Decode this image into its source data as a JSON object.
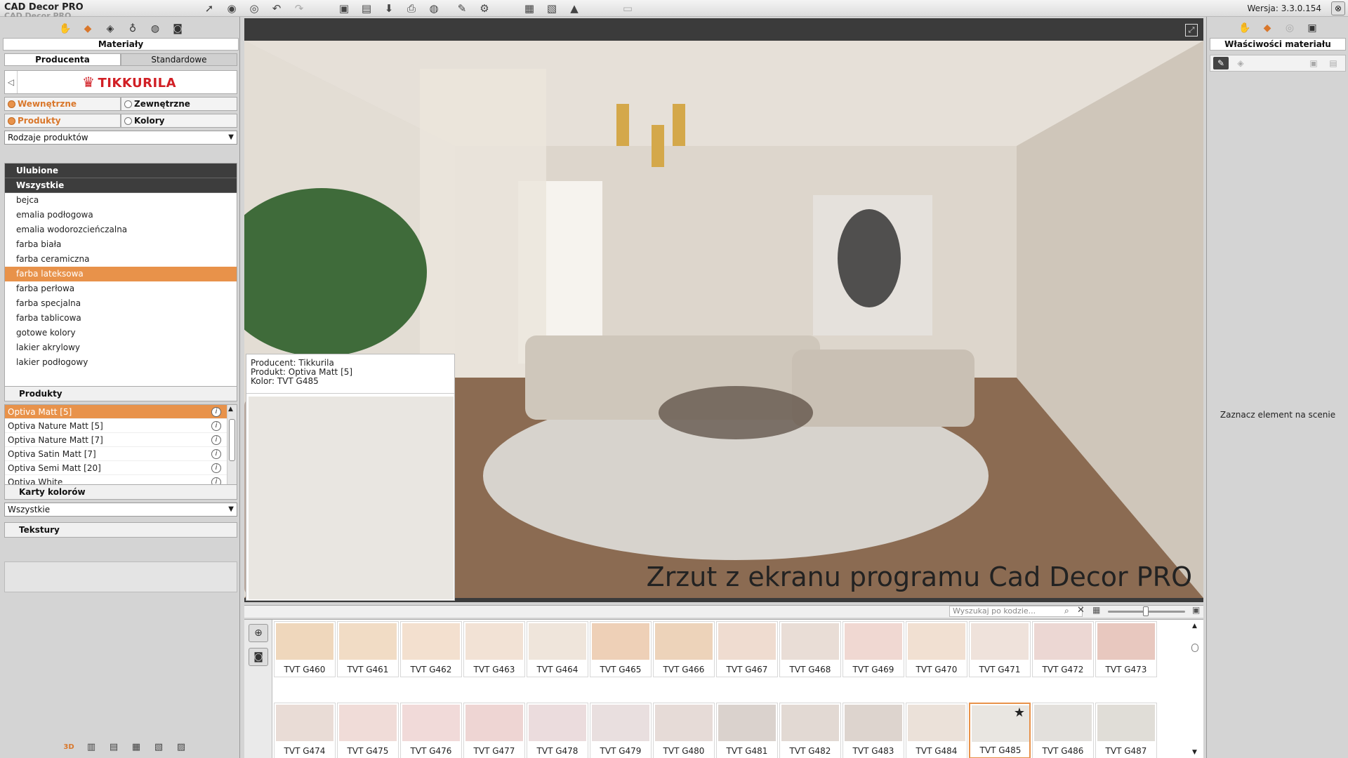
{
  "app": {
    "title": "CAD Decor PRO",
    "title_ghost": "CAD Decor PRO",
    "version": "Wersja: 3.3.0.154",
    "close_glyph": "⊗"
  },
  "toolbar": {
    "buttons": [
      {
        "name": "select-arrow-icon",
        "glyph": "➚"
      },
      {
        "name": "eye-icon",
        "glyph": "◉"
      },
      {
        "name": "eye-alt-icon",
        "glyph": "◎"
      },
      {
        "name": "undo-icon",
        "glyph": "↶"
      },
      {
        "name": "redo-icon",
        "glyph": "↷"
      },
      {
        "name": "save-icon",
        "glyph": "▣"
      },
      {
        "name": "save-as-icon",
        "glyph": "▤"
      },
      {
        "name": "export-icon",
        "glyph": "⬇"
      },
      {
        "name": "print-icon",
        "glyph": "⎙"
      },
      {
        "name": "globe-icon",
        "glyph": "◍"
      },
      {
        "name": "edit-icon",
        "glyph": "✎"
      },
      {
        "name": "settings-icon",
        "glyph": "⚙"
      },
      {
        "name": "view-2d-icon",
        "glyph": "▦"
      },
      {
        "name": "view-3d-icon",
        "glyph": "▧"
      },
      {
        "name": "render-icon",
        "glyph": "▲"
      },
      {
        "name": "window-icon",
        "glyph": "▭"
      }
    ]
  },
  "left": {
    "panel_tab_icons": [
      "hand-icon",
      "material-brush-icon",
      "layers-icon",
      "lamp-icon",
      "texture-icon",
      "camera-icon"
    ],
    "panel_tab_glyphs": [
      "✋",
      "◆",
      "◈",
      "♁",
      "◍",
      "◙"
    ],
    "title": "Materiały",
    "source_tabs": [
      "Producenta",
      "Standardowe"
    ],
    "back_glyph": "◁",
    "brand": "TIKKURILA",
    "brand_crown": "♛",
    "options_row1": [
      "Wewnętrzne",
      "Zewnętrzne"
    ],
    "options_row2": [
      "Produkty",
      "Kolory"
    ],
    "product_types_select": "Rodzaje produktów",
    "cat_heads": [
      "Ulubione",
      "Wszystkie"
    ],
    "categories": [
      "bejca",
      "emalia podłogowa",
      "emalia wodorozcieńczalna",
      "farba biała",
      "farba ceramiczna",
      "farba lateksowa",
      "farba perłowa",
      "farba specjalna",
      "farba tablicowa",
      "gotowe kolory",
      "lakier akrylowy",
      "lakier podłogowy"
    ],
    "selected_category": "farba lateksowa",
    "products_head": "Produkty",
    "products": [
      "Optiva Matt [5]",
      "Optiva Nature Matt [5]",
      "Optiva Nature Matt [7]",
      "Optiva Satin Matt [7]",
      "Optiva Semi Matt [20]",
      "Optiva White"
    ],
    "info_glyph": "i",
    "color_cards_head": "Karty kolorów",
    "color_cards_select": "Wszystkie",
    "textures_head": "Tekstury",
    "bottom_tab_labels": [
      "3D",
      "▥",
      "▤",
      "▦",
      "▧",
      "▨"
    ]
  },
  "view": {
    "caption": "Zrzut z ekranu programu Cad Decor PRO",
    "maximize_glyph": "⤢",
    "info_lines": [
      "Producent: Tikkurila",
      "Produkt: Optiva Matt [5]",
      "Kolor: TVT G485"
    ],
    "selected_color_hex": "#e9e6e1"
  },
  "right": {
    "tab_glyphs": [
      "✋",
      "◆",
      "◎",
      "▣"
    ],
    "title": "Właściwości materiału",
    "tool_glyphs": [
      "✎",
      "◈",
      "▣",
      "▤"
    ],
    "hint": "Zaznacz element na scenie"
  },
  "swatches": {
    "search_placeholder": "Wyszukaj po kodzie...",
    "search_glyph": "⌕",
    "clear_glyph": "✕",
    "grid_glyph": "▦",
    "grid2_glyph": "▣",
    "zoom_in_glyph": "⊕",
    "camera_glyph": "◙",
    "star_glyph": "★",
    "selected": "TVT G485",
    "zoom_level": 0.45,
    "rows": [
      [
        {
          "code": "TVT G460",
          "color": "#efd7bc"
        },
        {
          "code": "TVT G461",
          "color": "#f1dcc5"
        },
        {
          "code": "TVT G462",
          "color": "#f3e0cf"
        },
        {
          "code": "TVT G463",
          "color": "#f2e2d5"
        },
        {
          "code": "TVT G464",
          "color": "#efe5db"
        },
        {
          "code": "TVT G465",
          "color": "#eed0b7"
        },
        {
          "code": "TVT G466",
          "color": "#edd3ba"
        },
        {
          "code": "TVT G467",
          "color": "#efdcd0"
        },
        {
          "code": "TVT G468",
          "color": "#e9ddd6"
        },
        {
          "code": "TVT G469",
          "color": "#f0d8d2"
        },
        {
          "code": "TVT G470",
          "color": "#f1e0d2"
        },
        {
          "code": "TVT G471",
          "color": "#efe2db"
        },
        {
          "code": "TVT G472",
          "color": "#ecd7d3"
        },
        {
          "code": "TVT G473",
          "color": "#e8c8bf"
        }
      ],
      [
        {
          "code": "TVT G474",
          "color": "#e9dcd6"
        },
        {
          "code": "TVT G475",
          "color": "#f0dcd8"
        },
        {
          "code": "TVT G476",
          "color": "#f1dad9"
        },
        {
          "code": "TVT G477",
          "color": "#eed5d3"
        },
        {
          "code": "TVT G478",
          "color": "#ebdcdd"
        },
        {
          "code": "TVT G479",
          "color": "#e9dfdf"
        },
        {
          "code": "TVT G480",
          "color": "#e6dbd7"
        },
        {
          "code": "TVT G481",
          "color": "#dad2cd"
        },
        {
          "code": "TVT G482",
          "color": "#e2d9d3"
        },
        {
          "code": "TVT G483",
          "color": "#ddd4ce"
        },
        {
          "code": "TVT G484",
          "color": "#ebe1d9"
        },
        {
          "code": "TVT G485",
          "color": "#e9e6e1"
        },
        {
          "code": "TVT G486",
          "color": "#e3e0dc"
        },
        {
          "code": "TVT G487",
          "color": "#e0ddd7"
        }
      ]
    ]
  }
}
